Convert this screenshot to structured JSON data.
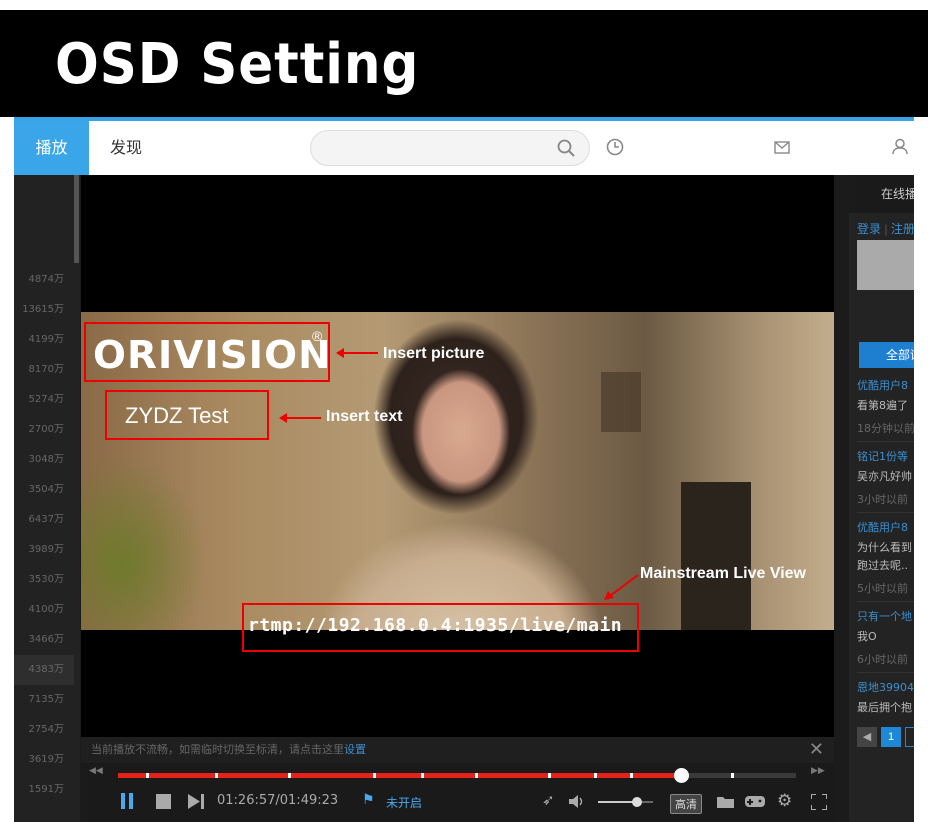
{
  "banner": {
    "title": "OSD Setting"
  },
  "topbar": {
    "tabs": [
      {
        "label": "播放"
      },
      {
        "label": "发现"
      }
    ],
    "search_placeholder": ""
  },
  "sidebar": {
    "counts": [
      "4874万",
      "13615万",
      "4199万",
      "8170万",
      "5274万",
      "2700万",
      "3048万",
      "3504万",
      "6437万",
      "3989万",
      "3530万",
      "4100万",
      "3466万",
      "4383万",
      "7135万",
      "2754万",
      "3619万",
      "1591万"
    ]
  },
  "video": {
    "osd_logo": "ORIVISION",
    "osd_logo_mark": "®",
    "osd_text": "ZYDZ Test",
    "stream_url": "rtmp://192.168.0.4:1935/live/main",
    "annotations": {
      "picture": "Insert picture",
      "text": "Insert text",
      "mainstream": "Mainstream Live View"
    }
  },
  "notice": {
    "message": "当前播放不流畅，如需临时切换至标清，请点击这里",
    "link": "设置"
  },
  "controls": {
    "time": "01:26:57/01:49:23",
    "status": "未开启",
    "quality": "高清",
    "progress": 0.83,
    "volume": 0.7
  },
  "right_panel": {
    "header": "在线播放",
    "login": "登录",
    "register": "注册",
    "all_button": "全部评论",
    "messages": [
      {
        "user": "优酷用户8",
        "body": "看第8遍了",
        "time": "18分钟以前"
      },
      {
        "user": "铭记1份等",
        "body": "吴亦凡好帅",
        "time": "3小时以前"
      },
      {
        "user": "优酷用户8",
        "body": "为什么看到",
        "body2": "跑过去呢..",
        "time": "5小时以前"
      },
      {
        "user": "只有一个地",
        "body": "我O",
        "time": "6小时以前"
      },
      {
        "user": "恩地39904",
        "body": "最后拥个抱",
        "time": ""
      }
    ],
    "page": "1"
  }
}
